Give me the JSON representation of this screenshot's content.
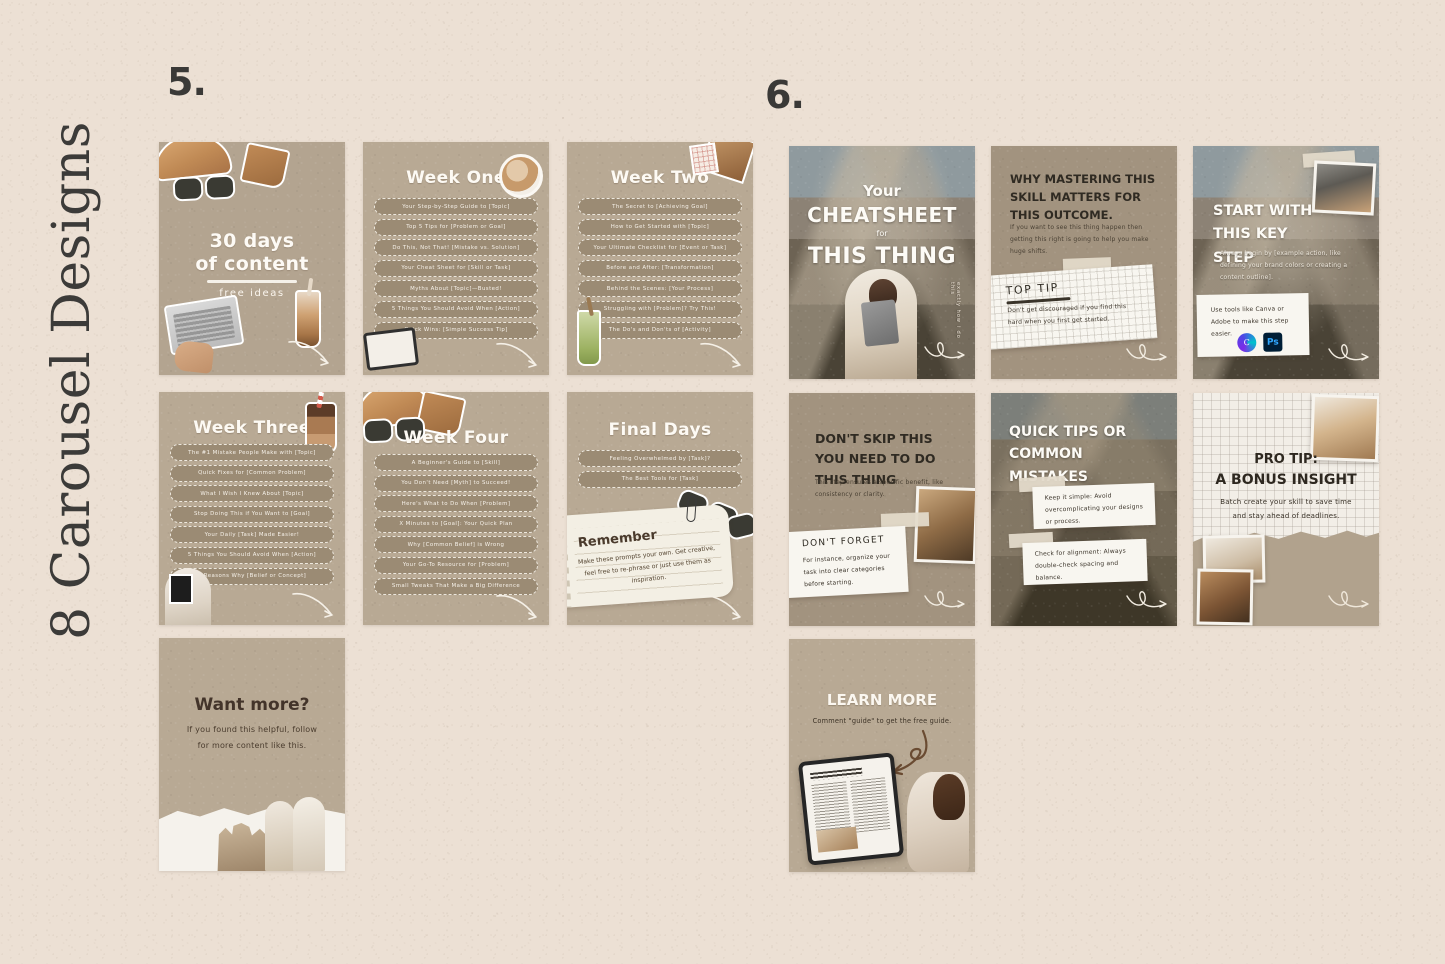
{
  "page": {
    "side_title": "8 Carousel Designs",
    "background_color": "#ece0d4"
  },
  "groups": [
    {
      "number": "5."
    },
    {
      "number": "6."
    }
  ],
  "cards": {
    "thirty_days": {
      "title_line1": "30 days",
      "title_line2": "of content",
      "subtitle": "free ideas"
    },
    "week_one": {
      "heading": "Week One",
      "items": [
        "Your Step-by-Step Guide to [Topic]",
        "Top 5 Tips for [Problem or Goal]",
        "Do This, Not That! [Mistake vs. Solution]",
        "Your Cheat Sheet for [Skill or Task]",
        "Myths About [Topic]—Busted!",
        "5 Things You Should Avoid When [Action]",
        "Quick Wins: [Simple Success Tip]"
      ]
    },
    "week_two": {
      "heading": "Week Two",
      "items": [
        "The Secret to [Achieving Goal]",
        "How to Get Started with [Topic]",
        "Your Ultimate Checklist for [Event or Task]",
        "Before and After: [Transformation]",
        "Behind the Scenes: [Your Process]",
        "Struggling with [Problem]? Try This!",
        "The Do's and Don'ts of [Activity]"
      ]
    },
    "week_three": {
      "heading": "Week Three",
      "items": [
        "The #1 Mistake People Make with [Topic]",
        "Quick Fixes for [Common Problem]",
        "What I Wish I Knew About [Topic]",
        "Stop Doing This if You Want to [Goal]",
        "Your Daily [Task] Made Easier!",
        "5 Things You Should Avoid When [Action]",
        "3 Reasons Why [Belief or Concept]"
      ]
    },
    "week_four": {
      "heading": "Week Four",
      "items": [
        "A Beginner's Guide to [Skill]",
        "You Don't Need [Myth] to Succeed!",
        "Here's What to Do When [Problem]",
        "X Minutes to [Goal]: Your Quick Plan",
        "Why [Common Belief] is Wrong",
        "Your Go-To Resource for [Problem]",
        "Small Tweaks That Make a Big Difference"
      ]
    },
    "final_days": {
      "heading": "Final Days",
      "items": [
        "Feeling Overwhelmed by [Task]?",
        "The Best Tools for [Task]"
      ],
      "note_title": "Remember",
      "note_body": "Make these prompts your own. Get creative, feel free to re-phrase or just use them as inspiration."
    },
    "want_more": {
      "heading": "Want more?",
      "body": "If you found this helpful, follow for more content like this."
    },
    "cheatsheet": {
      "line1": "Your",
      "line2": "CHEATSHEET",
      "line3": "for",
      "line4": "THIS THING",
      "curved_text": "exactly how i do this"
    },
    "why_mastering": {
      "heading": "WHY MASTERING THIS SKILL MATTERS FOR THIS OUTCOME.",
      "body": "If you want to see this thing happen then getting this right is going to help you make huge shifts.",
      "note_title": "TOP TIP",
      "note_body": "Don't get discouraged if you find this hard when you first get started."
    },
    "start_with": {
      "heading": "START WITH THIS KEY STEP",
      "body": "Always begin by [example action, like defining your brand colors or creating a content outline].",
      "note_body": "Use tools like Canva or Adobe to make this step easier.",
      "app_icons": [
        {
          "name": "canva-icon",
          "glyph": "C"
        },
        {
          "name": "photoshop-icon",
          "glyph": "Ps"
        }
      ]
    },
    "dont_skip": {
      "heading": "DON'T SKIP THIS YOU NEED TO DO THIS THING",
      "body": "This step ensures a specific benefit, like consistency or clarity.",
      "note_title": "DON'T FORGET",
      "note_body": "For instance, organize your task into clear categories before starting."
    },
    "quick_tips": {
      "heading": "QUICK TIPS OR COMMON MISTAKES",
      "note1": "Keep it simple: Avoid overcomplicating your designs or process.",
      "note2": "Check for alignment: Always double-check spacing and balance."
    },
    "pro_tip": {
      "line1": "PRO TIP:",
      "line2": "A BONUS INSIGHT",
      "body": "Batch create your skill to save time and stay ahead of deadlines."
    },
    "learn_more": {
      "heading": "LEARN MORE",
      "body": "Comment \"guide\" to get the free guide."
    }
  }
}
